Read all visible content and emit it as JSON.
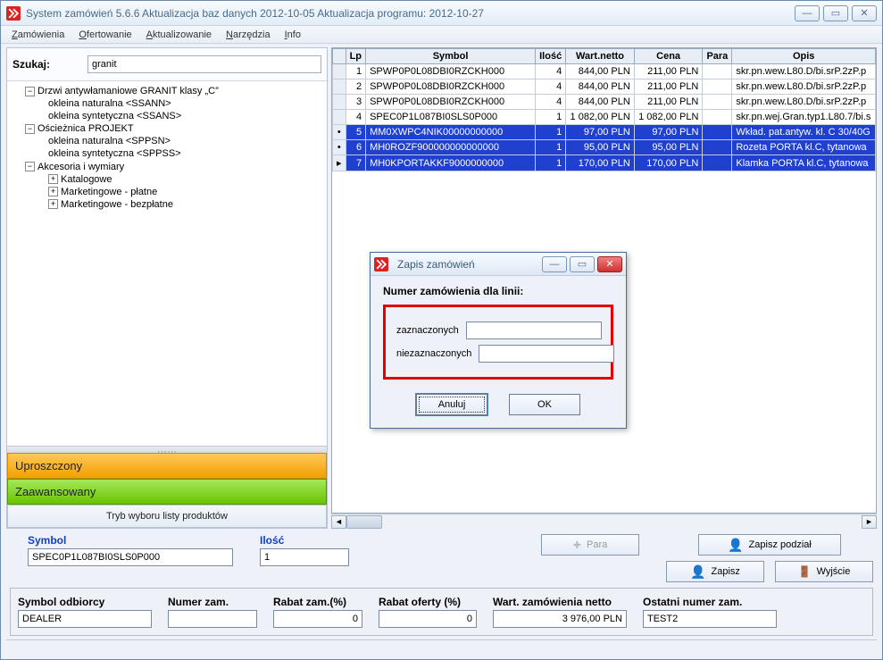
{
  "title": "System zamówień 5.6.6  Aktualizacja baz danych 2012-10-05  Aktualizacja programu: 2012-10-27",
  "menu": {
    "m0": "Zamówienia",
    "m1": "Ofertowanie",
    "m2": "Aktualizowanie",
    "m3": "Narzędzia",
    "m4": "Info"
  },
  "search": {
    "label": "Szukaj:",
    "value": "granit"
  },
  "tree": {
    "n0": "Drzwi antywłamaniowe GRANIT klasy „C”",
    "n0a": "okleina naturalna <SSANN>",
    "n0b": "okleina syntetyczna <SSANS>",
    "n1": "Ościeżnica PROJEKT",
    "n1a": "okleina naturalna <SPPSN>",
    "n1b": "okleina syntetyczna <SPPSS>",
    "n2": "Akcesoria i wymiary",
    "n2a": "Katalogowe",
    "n2b": "Marketingowe - płatne",
    "n2c": "Marketingowe - bezpłatne"
  },
  "modeButtons": {
    "simple": "Uproszczony",
    "advanced": "Zaawansowany",
    "picker": "Tryb wyboru listy produktów"
  },
  "gridHeaders": {
    "lp": "Lp",
    "symbol": "Symbol",
    "ilosc": "Ilość",
    "wart": "Wart.netto",
    "cena": "Cena",
    "para": "Para",
    "opis": "Opis"
  },
  "rows": [
    {
      "lp": "1",
      "sym": "SPWP0P0L08DBI0RZCKH000",
      "il": "4",
      "w": "844,00 PLN",
      "c": "211,00 PLN",
      "o": "skr.pn.wew.L80.D/bi.srP.2zP.p"
    },
    {
      "lp": "2",
      "sym": "SPWP0P0L08DBI0RZCKH000",
      "il": "4",
      "w": "844,00 PLN",
      "c": "211,00 PLN",
      "o": "skr.pn.wew.L80.D/bi.srP.2zP.p"
    },
    {
      "lp": "3",
      "sym": "SPWP0P0L08DBI0RZCKH000",
      "il": "4",
      "w": "844,00 PLN",
      "c": "211,00 PLN",
      "o": "skr.pn.wew.L80.D/bi.srP.2zP.p"
    },
    {
      "lp": "4",
      "sym": "SPEC0P1L087BI0SLS0P000",
      "il": "1",
      "w": "1 082,00 PLN",
      "c": "1 082,00 PLN",
      "o": "skr.pn.wej.Gran.typ1.L80.7/bi.s"
    },
    {
      "lp": "5",
      "sym": "MM0XWPC4NIK00000000000",
      "il": "1",
      "w": "97,00 PLN",
      "c": "97,00 PLN",
      "o": "Wkład. pat.antyw. kl. C 30/40G"
    },
    {
      "lp": "6",
      "sym": "MH0ROZF900000000000000",
      "il": "1",
      "w": "95,00 PLN",
      "c": "95,00 PLN",
      "o": "Rozeta PORTA kl.C, tytanowa"
    },
    {
      "lp": "7",
      "sym": "MH0KPORTAKKF9000000000",
      "il": "1",
      "w": "170,00 PLN",
      "c": "170,00 PLN",
      "o": "Klamka PORTA kl.C, tytanowa"
    }
  ],
  "mid": {
    "symbolLabel": "Symbol",
    "symbolValue": "SPEC0P1L087BI0SLS0P000",
    "iloscLabel": "Ilość",
    "iloscValue": "1",
    "paraBtn": "Para",
    "zapiszPodzial": "Zapisz podział",
    "zapisz": "Zapisz",
    "wyjscie": "Wyjście"
  },
  "bottom": {
    "l0": "Symbol odbiorcy",
    "v0": "DEALER",
    "l1": "Numer zam.",
    "v1": "",
    "l2": "Rabat zam.(%)",
    "v2": "0",
    "l3": "Rabat oferty (%)",
    "v3": "0",
    "l4": "Wart. zamówienia netto",
    "v4": "3 976,00 PLN",
    "l5": "Ostatni numer zam.",
    "v5": "TEST2"
  },
  "dialog": {
    "title": "Zapis zamówień",
    "head": "Numer zamówienia dla linii:",
    "f0": "zaznaczonych",
    "f1": "niezaznaczonych",
    "cancel": "Anuluj",
    "ok": "OK"
  }
}
